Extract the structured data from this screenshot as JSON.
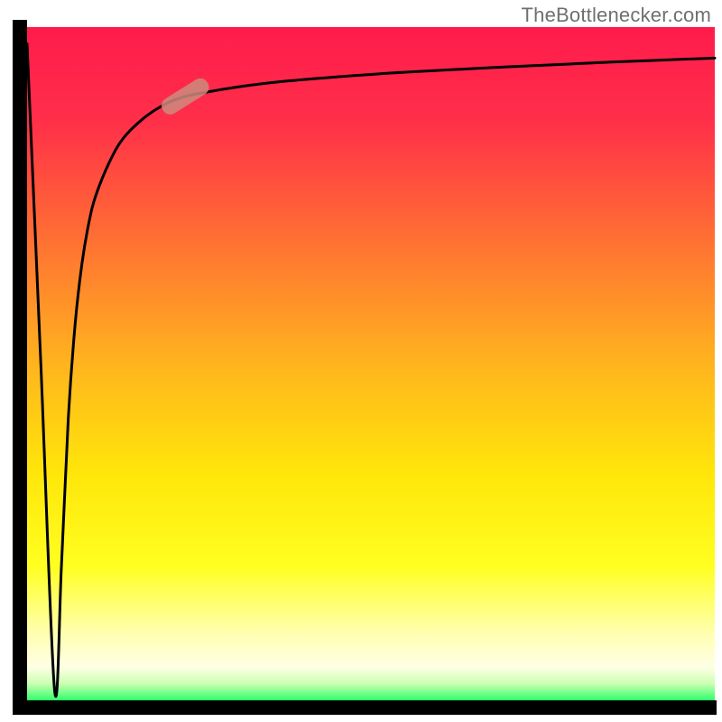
{
  "watermark": "TheBottlenecker.com",
  "chart_data": {
    "type": "line",
    "title": "",
    "xlabel": "",
    "ylabel": "",
    "xlim": [
      0,
      100
    ],
    "ylim": [
      0,
      100
    ],
    "gradient_stops": [
      {
        "pos": 0.0,
        "color": "#ff1b4c"
      },
      {
        "pos": 0.14,
        "color": "#ff2f49"
      },
      {
        "pos": 0.3,
        "color": "#ff6a35"
      },
      {
        "pos": 0.5,
        "color": "#ffb41e"
      },
      {
        "pos": 0.66,
        "color": "#ffe50a"
      },
      {
        "pos": 0.8,
        "color": "#ffff20"
      },
      {
        "pos": 0.9,
        "color": "#ffffb0"
      },
      {
        "pos": 0.95,
        "color": "#ffffe6"
      },
      {
        "pos": 0.975,
        "color": "#cdffb2"
      },
      {
        "pos": 1.0,
        "color": "#2eff6a"
      }
    ],
    "x": [
      0,
      2,
      4,
      5,
      6,
      7,
      8,
      9,
      10,
      12,
      14,
      17,
      20,
      23,
      27,
      32,
      38,
      45,
      55,
      70,
      85,
      100
    ],
    "values": [
      97.5,
      50,
      1.5,
      20,
      42,
      56,
      65,
      71,
      75,
      80,
      83.5,
      86.5,
      88.5,
      89.7,
      90.5,
      91.3,
      92.0,
      92.6,
      93.3,
      94.1,
      94.8,
      95.4
    ],
    "marker": {
      "x": 23,
      "y": 89.7,
      "angle_deg": -32
    },
    "axis_color": "#000000",
    "curve_color": "#000000",
    "marker_color": "#cc8b7d"
  }
}
